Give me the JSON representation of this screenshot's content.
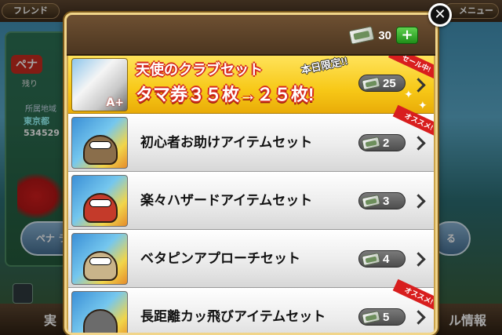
{
  "background": {
    "friend_tab": "フレンド",
    "menu_tab": "メニュー",
    "team_name": "ペナ",
    "remaining": "残り",
    "region_label": "所属地域",
    "prefecture": "東京都",
    "number": "534529",
    "left_button": "ペナ\nラ",
    "right_button": "る",
    "bottom_left": "実",
    "bottom_right": "ル情報"
  },
  "shop": {
    "balance": "30",
    "plus_label": "+",
    "close_label": "✕",
    "featured": {
      "title": "天使のクラブセット",
      "limited": "本日限定!!",
      "deal": "タマ券３５枚→２５枚!",
      "ribbon": "セール中!",
      "price": "25",
      "grade": "A+"
    },
    "items": [
      {
        "name": "初心者お助けアイテムセット",
        "price": "2",
        "ribbon": "オススメ!"
      },
      {
        "name": "楽々ハザードアイテムセット",
        "price": "3",
        "ribbon": ""
      },
      {
        "name": "ベタピンアプローチセット",
        "price": "4",
        "ribbon": ""
      },
      {
        "name": "長距離カッ飛びアイテムセット",
        "price": "5",
        "ribbon": "オススメ!"
      }
    ]
  },
  "icons": {
    "ticket": "ticket-icon",
    "chevron": "chevron-right-icon",
    "close": "close-icon",
    "plus": "plus-icon"
  },
  "colors": {
    "accent_red": "#d52a1e",
    "featured_yellow": "#f7c817",
    "header_brown": "#5d4630",
    "plus_green": "#1f8e19"
  }
}
